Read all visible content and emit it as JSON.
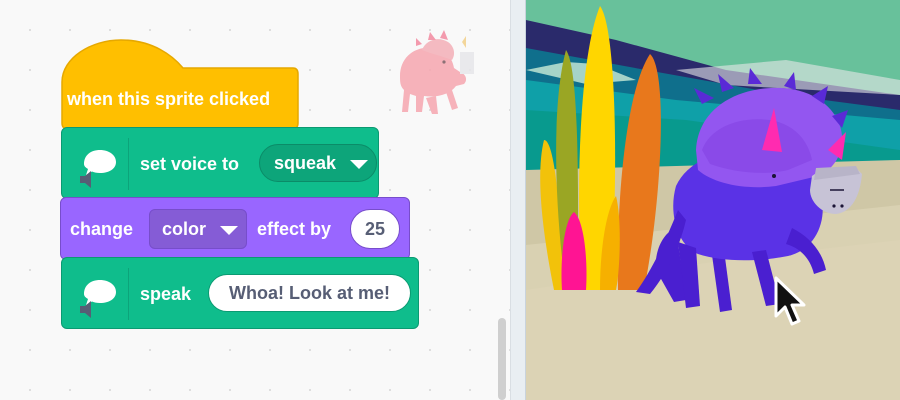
{
  "blocks": {
    "hat": {
      "label": "when this sprite clicked"
    },
    "set_voice": {
      "label": "set voice to",
      "dropdown_value": "squeak"
    },
    "change_effect": {
      "label_before": "change",
      "dropdown_value": "color",
      "label_after": "effect by",
      "value": "25"
    },
    "speak": {
      "label": "speak",
      "input_value": "Whoa! Look at me!"
    }
  },
  "icons": {
    "text_to_speech": "speech-bubble-speaker-icon",
    "cursor": "mouse-pointer-icon"
  },
  "colors": {
    "events_block": "#ffbf00",
    "extension_block": "#0fbd8c",
    "looks_block": "#9966ff",
    "stage_sky": "#68c19b",
    "sprite_body": "#7b4cf0"
  }
}
